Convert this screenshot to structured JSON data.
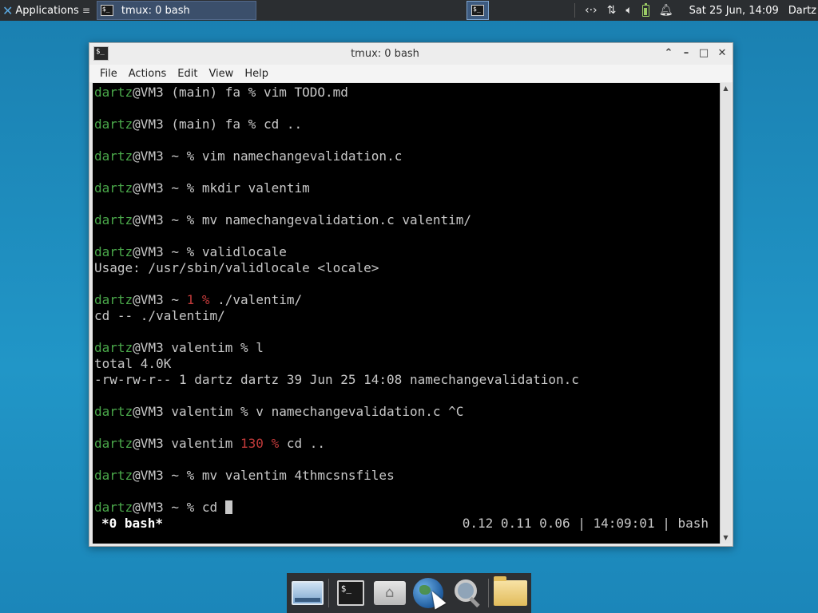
{
  "top_panel": {
    "apps_label": "Applications",
    "taskbar_item": "tmux: 0 bash",
    "clock": "Sat 25 Jun, 14:09",
    "user": "Dartz",
    "icons": [
      "network-icon",
      "updown-arrows-icon",
      "volume-icon",
      "battery-icon",
      "bell-icon"
    ]
  },
  "window": {
    "title": "tmux: 0 bash",
    "menu": [
      "File",
      "Actions",
      "Edit",
      "View",
      "Help"
    ]
  },
  "terminal": {
    "lines": [
      {
        "user": "dartz",
        "host": "@VM3 (main) fa ",
        "code": "",
        "rest": "% vim TODO.md"
      },
      {
        "user": "dartz",
        "host": "@VM3 (main) fa ",
        "code": "",
        "rest": "% cd .."
      },
      {
        "user": "dartz",
        "host": "@VM3 ~ ",
        "code": "",
        "rest": "% vim namechangevalidation.c"
      },
      {
        "user": "dartz",
        "host": "@VM3 ~ ",
        "code": "",
        "rest": "% mkdir valentim"
      },
      {
        "user": "dartz",
        "host": "@VM3 ~ ",
        "code": "",
        "rest": "% mv namechangevalidation.c valentim/"
      },
      {
        "user": "dartz",
        "host": "@VM3 ~ ",
        "code": "",
        "rest": "% validlocale"
      },
      {
        "output": "Usage: /usr/sbin/validlocale <locale>"
      },
      {
        "user": "dartz",
        "host": "@VM3 ~ ",
        "code": "1 %",
        "rest": " ./valentim/"
      },
      {
        "output": "cd -- ./valentim/"
      },
      {
        "user": "dartz",
        "host": "@VM3 valentim ",
        "code": "",
        "rest": "% l"
      },
      {
        "output": "total 4.0K"
      },
      {
        "output": "-rw-rw-r-- 1 dartz dartz 39 Jun 25 14:08 namechangevalidation.c"
      },
      {
        "user": "dartz",
        "host": "@VM3 valentim ",
        "code": "",
        "rest": "% v namechangevalidation.c ^C"
      },
      {
        "user": "dartz",
        "host": "@VM3 valentim ",
        "code": "130 %",
        "rest": " cd .."
      },
      {
        "user": "dartz",
        "host": "@VM3 ~ ",
        "code": "",
        "rest": "% mv valentim 4thmcsnsfiles"
      },
      {
        "user": "dartz",
        "host": "@VM3 ~ ",
        "code": "",
        "rest": "% cd "
      }
    ],
    "status_left": "*0 bash*",
    "status_right": "0.12 0.11 0.06 | 14:09:01 | bash"
  },
  "dock": {
    "items": [
      "show-desktop-icon",
      "terminal-icon",
      "home-folder-icon",
      "web-browser-icon",
      "app-finder-icon",
      "files-folder-icon"
    ]
  }
}
